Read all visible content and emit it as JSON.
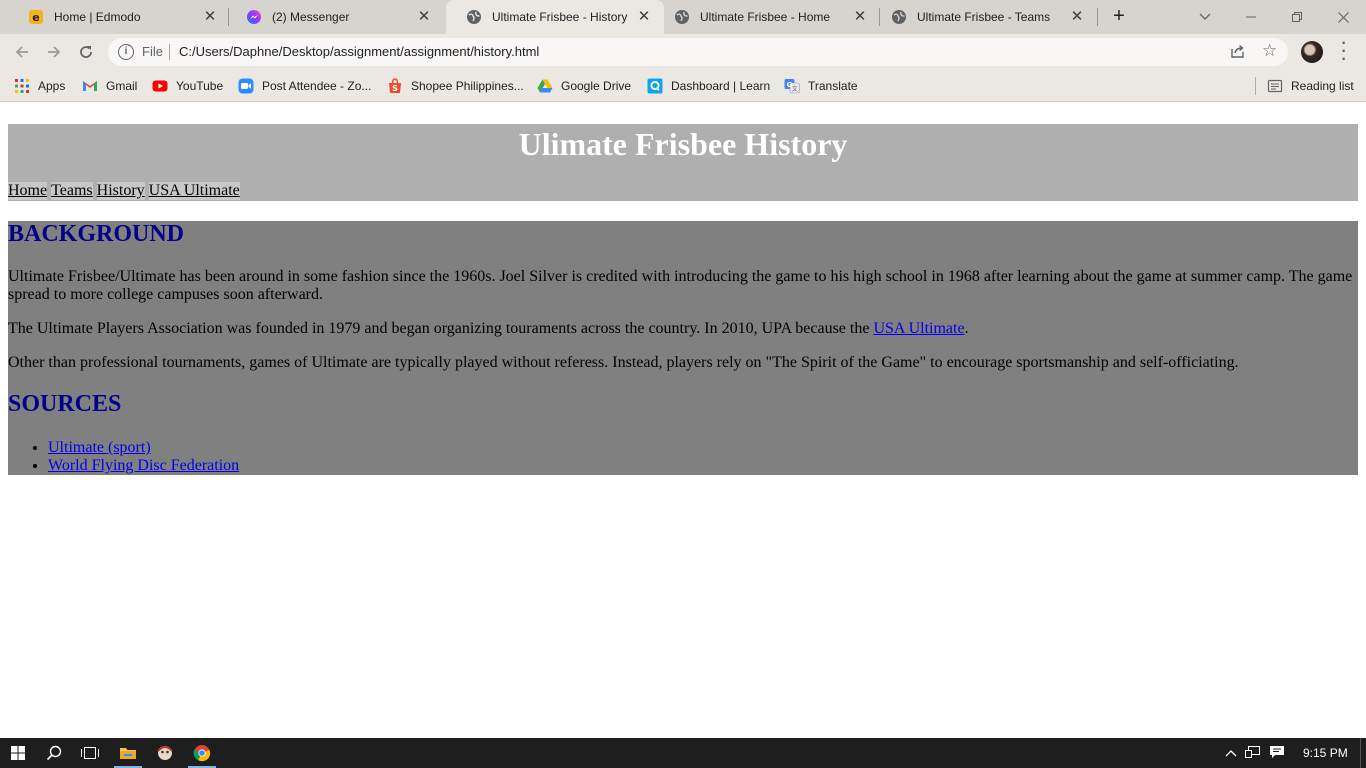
{
  "browser": {
    "tabs": [
      {
        "title": "Home | Edmodo",
        "icon": "edmodo-icon"
      },
      {
        "title": "(2) Messenger",
        "icon": "messenger-icon"
      },
      {
        "title": "Ultimate Frisbee - History",
        "icon": "globe-icon",
        "active": true
      },
      {
        "title": "Ultimate Frisbee - Home",
        "icon": "globe-icon"
      },
      {
        "title": "Ultimate Frisbee - Teams",
        "icon": "globe-icon"
      }
    ],
    "address": {
      "scheme_label": "File",
      "url": "C:/Users/Daphne/Desktop/assignment/assignment/history.html"
    },
    "bookmarks": [
      {
        "label": "Apps",
        "icon": "apps-grid-icon"
      },
      {
        "label": "Gmail",
        "icon": "gmail-icon"
      },
      {
        "label": "YouTube",
        "icon": "youtube-icon"
      },
      {
        "label": "Post Attendee - Zo...",
        "icon": "zoom-icon"
      },
      {
        "label": "Shopee Philippines...",
        "icon": "shopee-icon"
      },
      {
        "label": "Google Drive",
        "icon": "google-drive-icon"
      },
      {
        "label": "Dashboard | Learn",
        "icon": "learn-icon"
      },
      {
        "label": "Translate",
        "icon": "translate-icon"
      }
    ],
    "reading_list": "Reading list"
  },
  "page": {
    "title": "Ulimate Frisbee History",
    "nav": [
      "Home",
      "Teams",
      "History",
      "USA Ultimate"
    ],
    "background_heading": "BACKGROUND",
    "paragraphs": {
      "p1": "Ultimate Frisbee/Ultimate has been around in some fashion since the 1960s. Joel Silver is credited with introducing the game to his high school in 1968 after learning about the game at summer camp. The game spread to more college campuses soon afterward.",
      "p2_before": "The Ultimate Players Association was founded in 1979 and began organizing touraments across the country. In 2010, UPA because the ",
      "p2_link": "USA Ultimate",
      "p2_after": ".",
      "p3": "Other than professional tournaments, games of Ultimate are typically played without referess. Instead, players rely on \"The Spirit of the Game\" to encourage sportsmanship and self-officiating."
    },
    "sources_heading": "SOURCES",
    "sources": [
      "Ultimate (sport)",
      "World Flying Disc Federation"
    ]
  },
  "taskbar": {
    "clock": "9:15 PM"
  },
  "colors": {
    "header_bg": "#afafaf",
    "main_bg": "#808080",
    "heading": "#00008b",
    "link": "#0000ee"
  }
}
